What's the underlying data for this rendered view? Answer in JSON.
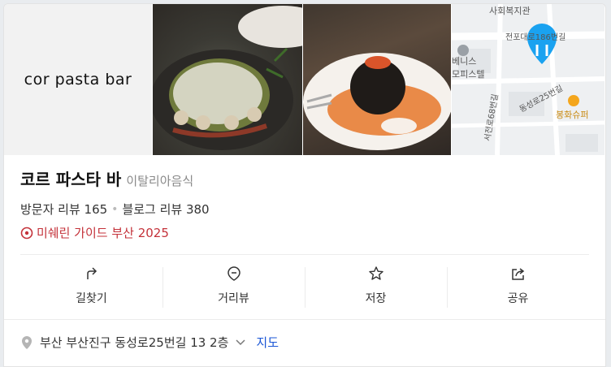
{
  "gallery": {
    "logo_text": "cor pasta bar",
    "map": {
      "labels": [
        "사회복지관",
        "전포대로186번길",
        "베니스",
        "모피스텔",
        "동성로25번길",
        "서전로68번길",
        "봉화슈퍼"
      ],
      "pin_color": "#1aa2f0",
      "store_color": "#f4a61d"
    }
  },
  "place": {
    "name": "코르 파스타 바",
    "category": "이탈리아음식",
    "visitor_reviews": "방문자 리뷰 165",
    "blog_reviews": "블로그 리뷰 380",
    "michelin": "미쉐린 가이드 부산 2025"
  },
  "actions": [
    {
      "label": "길찾기",
      "icon": "directions-icon"
    },
    {
      "label": "거리뷰",
      "icon": "streetview-icon"
    },
    {
      "label": "저장",
      "icon": "star-icon"
    },
    {
      "label": "공유",
      "icon": "share-icon"
    }
  ],
  "address": {
    "text": "부산 부산진구 동성로25번길 13 2층",
    "map_link": "지도"
  },
  "colors": {
    "michelin": "#c4323a",
    "link": "#1a56d6"
  }
}
